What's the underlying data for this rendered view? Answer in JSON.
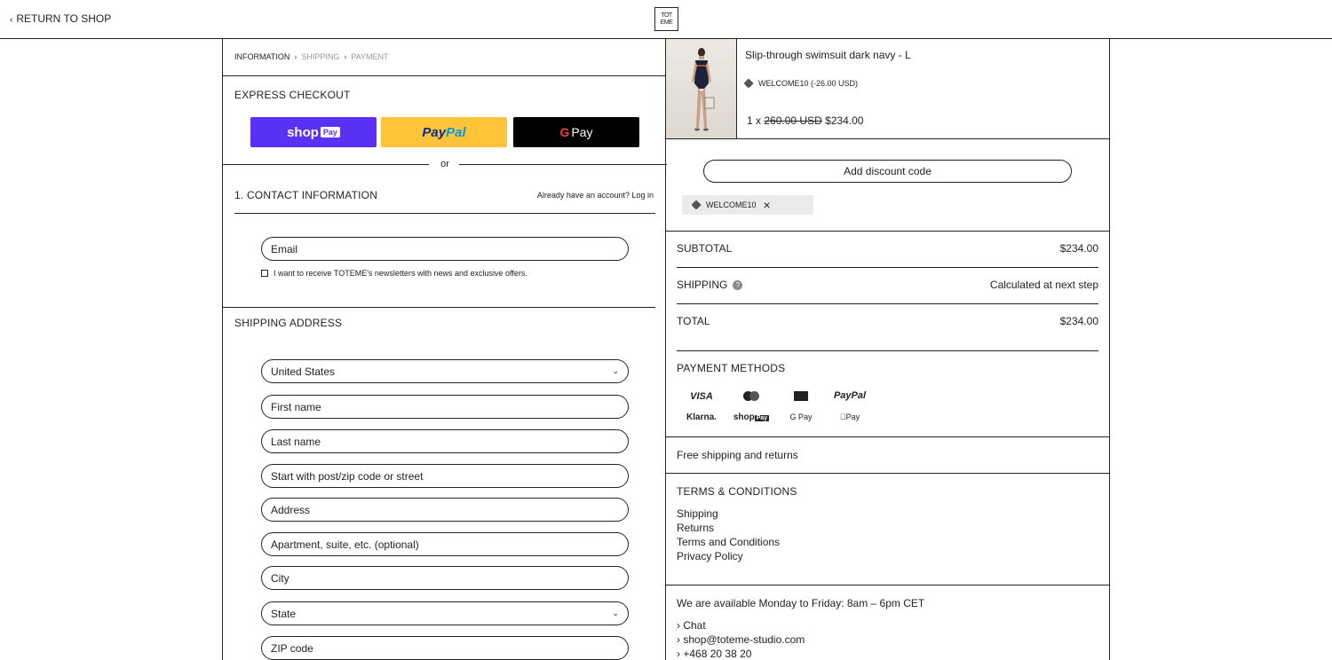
{
  "header": {
    "return_label": "RETURN TO SHOP",
    "logo_top": "TOT",
    "logo_bottom": "EME"
  },
  "breadcrumb": {
    "step1": "INFORMATION",
    "step2": "SHIPPING",
    "step3": "PAYMENT",
    "separator": "›"
  },
  "express": {
    "title": "EXPRESS CHECKOUT",
    "shoppay_label": "shop",
    "shoppay_pill": "Pay",
    "paypal_a": "Pay",
    "paypal_b": "Pal",
    "gpay_g": "G",
    "gpay_label": "Pay",
    "or_label": "or"
  },
  "contact": {
    "title": "1.  CONTACT INFORMATION",
    "login_text": "Already have an account? Log in",
    "email_placeholder": "Email",
    "newsletter_text": "I want to receive TOTEME's newsletters with news and exclusive offers."
  },
  "shipping": {
    "title": "SHIPPING ADDRESS",
    "country": "United States",
    "first_name": "First name",
    "last_name": "Last name",
    "lookup": "Start with post/zip code or street",
    "address": "Address",
    "apartment": "Apartment, suite, etc. (optional)",
    "city": "City",
    "state": "State",
    "zip": "ZIP code",
    "caret": "⌄"
  },
  "product": {
    "name": "Slip-through swimsuit dark navy - L",
    "code": "WELCOME10 (-26.00 USD)",
    "qty_prefix": "1 x",
    "original_price": "260.00 USD",
    "price": "$234.00"
  },
  "discount": {
    "button_label": "Add discount code",
    "applied_code": "WELCOME10",
    "remove_icon": "×"
  },
  "totals": {
    "subtotal_label": "SUBTOTAL",
    "subtotal_value": "$234.00",
    "shipping_label": "SHIPPING",
    "shipping_value": "Calculated at next step",
    "total_label": "TOTAL",
    "total_value": "$234.00"
  },
  "payment_methods": {
    "title": "PAYMENT METHODS",
    "visa": "VISA",
    "paypal": "PayPal",
    "klarna": "Klarna.",
    "shoppay": "shop",
    "shoppay_pill": "Pay",
    "gpay": "G Pay",
    "applepay": "Pay"
  },
  "info": {
    "free_shipping": "Free shipping and returns",
    "terms_title": "TERMS & CONDITIONS",
    "links": [
      "Shipping",
      "Returns",
      "Terms and Conditions",
      "Privacy Policy"
    ],
    "availability": "We are available Monday to Friday: 8am – 6pm CET",
    "contacts": [
      "Chat",
      "shop@toteme-studio.com",
      "+468 20 38 20"
    ],
    "contact_marker": "›"
  }
}
